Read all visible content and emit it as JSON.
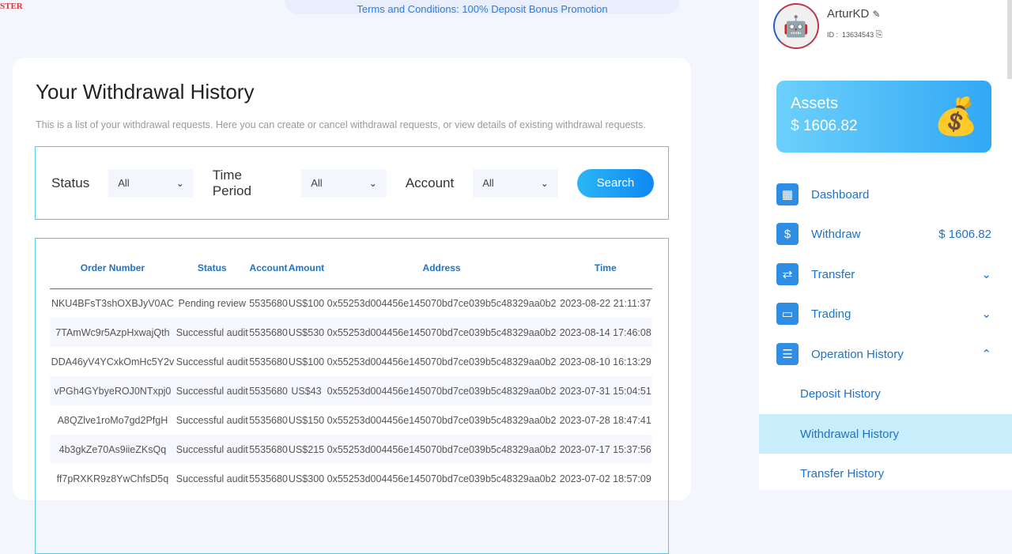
{
  "logo_text": "STER",
  "banner": "Terms and Conditions: 100% Deposit Bonus Promotion",
  "title": "Your Withdrawal History",
  "description": "This is a list of your withdrawal requests. Here you can create or cancel withdrawal requests, or view details of existing withdrawal requests.",
  "filters": {
    "status_label": "Status",
    "status_value": "All",
    "period_label": "Time Period",
    "period_value": "All",
    "account_label": "Account",
    "account_value": "All",
    "search": "Search"
  },
  "table": {
    "headers": [
      "Order Number",
      "Status",
      "Account",
      "Amount",
      "Address",
      "Time"
    ],
    "rows": [
      [
        "NKU4BFsT3shOXBJyV0AC",
        "Pending review",
        "5535680",
        "US$100",
        "0x55253d004456e145070bd7ce039b5c48329aa0b2",
        "2023-08-22 21:11:37"
      ],
      [
        "7TAmWc9r5AzpHxwajQth",
        "Successful audit",
        "5535680",
        "US$530",
        "0x55253d004456e145070bd7ce039b5c48329aa0b2",
        "2023-08-14 17:46:08"
      ],
      [
        "DDA46yV4YCxkOmHc5Y2v",
        "Successful audit",
        "5535680",
        "US$100",
        "0x55253d004456e145070bd7ce039b5c48329aa0b2",
        "2023-08-10 16:13:29"
      ],
      [
        "vPGh4GYbyeROJ0NTxpj0",
        "Successful audit",
        "5535680",
        "US$43",
        "0x55253d004456e145070bd7ce039b5c48329aa0b2",
        "2023-07-31 15:04:51"
      ],
      [
        "A8QZlve1roMo7gd2PfgH",
        "Successful audit",
        "5535680",
        "US$150",
        "0x55253d004456e145070bd7ce039b5c48329aa0b2",
        "2023-07-28 18:47:41"
      ],
      [
        "4b3gkZe70As9iieZKsQq",
        "Successful audit",
        "5535680",
        "US$215",
        "0x55253d004456e145070bd7ce039b5c48329aa0b2",
        "2023-07-17 15:37:56"
      ],
      [
        "ff7pRXKR9z8YwChfsD5q",
        "Successful audit",
        "5535680",
        "US$300",
        "0x55253d004456e145070bd7ce039b5c48329aa0b2",
        "2023-07-02 18:57:09"
      ]
    ]
  },
  "user": {
    "name": "ArturKD",
    "id_label": "ID :",
    "id": "13634543"
  },
  "assets": {
    "label": "Assets",
    "value": "$ 1606.82"
  },
  "nav": {
    "dashboard": "Dashboard",
    "withdraw": "Withdraw",
    "withdraw_amount": "$ 1606.82",
    "transfer": "Transfer",
    "trading": "Trading",
    "history": "Operation History",
    "deposit_history": "Deposit History",
    "withdrawal_history": "Withdrawal History",
    "transfer_history": "Transfer History"
  }
}
